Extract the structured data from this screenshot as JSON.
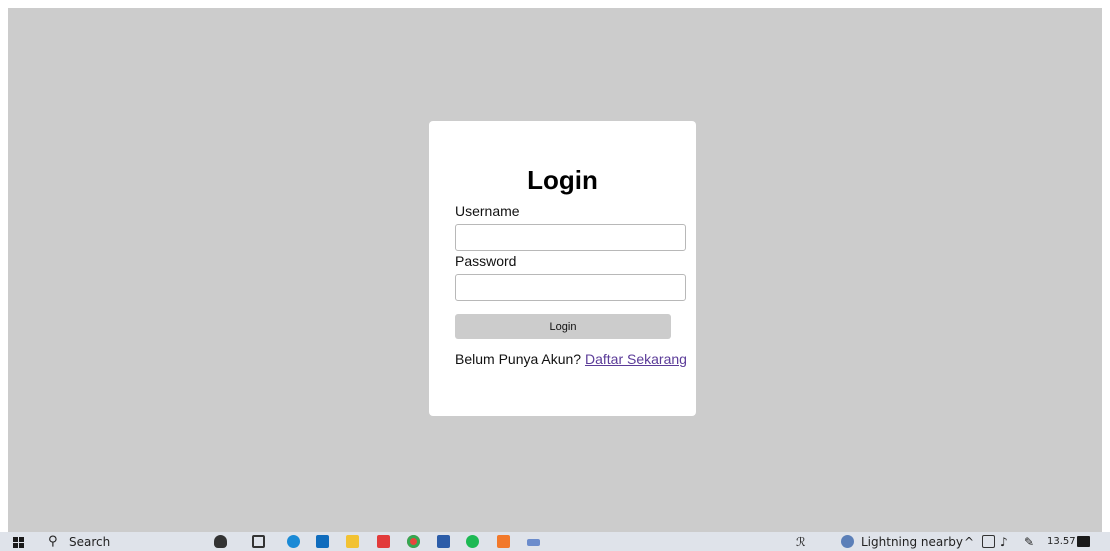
{
  "login": {
    "title": "Login",
    "username_label": "Username",
    "username_value": "",
    "password_label": "Password",
    "password_value": "",
    "submit_label": "Login",
    "register_prompt": "Belum Punya Akun?",
    "register_link": "Daftar Sekarang"
  },
  "taskbar": {
    "search_label": "Search",
    "weather_text": "Lightning nearby",
    "clock": "13.57",
    "icons": [
      "windows-start-icon",
      "search-icon",
      "tux-icon",
      "task-view-icon",
      "edge-icon",
      "mail-icon",
      "file-explorer-icon",
      "store-icon",
      "chrome-icon",
      "word-icon",
      "spotify-icon",
      "xampp-icon",
      "keyboard-icon",
      "people-icon",
      "weather-icon",
      "chevron-up-icon",
      "network-icon",
      "volume-icon",
      "pen-icon",
      "notification-icon"
    ]
  },
  "colors": {
    "page_background": "#cccccc",
    "card_background": "#ffffff",
    "button_background": "#cccccc",
    "link_color": "#5b3b98"
  }
}
